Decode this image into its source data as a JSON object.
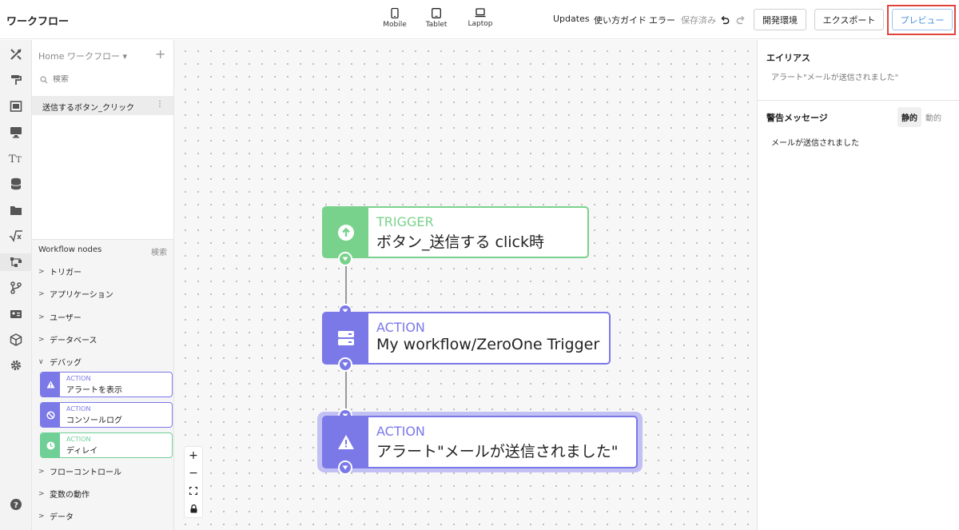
{
  "app": {
    "title": "ワークフロー"
  },
  "devices": {
    "mobile": "Mobile",
    "tablet": "Tablet",
    "laptop": "Laptop"
  },
  "toolbar": {
    "updates": "Updates",
    "guide": "使い方ガイド",
    "error": "エラー",
    "saved": "保存済み",
    "dev_env": "開発環境",
    "export": "エクスポート",
    "preview": "プレビュー"
  },
  "left_panel": {
    "header": "Home ワークフロー ▾",
    "search_placeholder": "検索",
    "workflow_item": "送信するボタン_クリック",
    "nodes_title": "Workflow nodes",
    "nodes_search": "検索",
    "categories": [
      "トリガー",
      "アプリケーション",
      "ユーザー",
      "データベース",
      "デバッグ",
      "フローコントロール",
      "変数の動作",
      "データ"
    ],
    "debug_nodes": [
      {
        "kind": "ACTION",
        "name": "アラートを表示",
        "color": "#7b78e8"
      },
      {
        "kind": "ACTION",
        "name": "コンソールログ",
        "color": "#7b78e8"
      },
      {
        "kind": "ACTION",
        "name": "ディレイ",
        "color": "#6fcf97"
      }
    ]
  },
  "canvas": {
    "nodes": [
      {
        "kind": "TRIGGER",
        "name": "ボタン_送信する click時",
        "color": "#79d28b"
      },
      {
        "kind": "ACTION",
        "name": "My workflow/ZeroOne Trigger",
        "color": "#7b78e8"
      },
      {
        "kind": "ACTION",
        "name": "アラート\"メールが送信されました\"",
        "color": "#7b78e8"
      }
    ]
  },
  "right_panel": {
    "alias_label": "エイリアス",
    "alias_placeholder": "アラート\"メールが送信されました\"",
    "message_label": "警告メッセージ",
    "mode_static": "静的",
    "mode_dynamic": "動的",
    "message_value": "メールが送信されました"
  },
  "colors": {
    "accent": "#4a90e2",
    "highlight": "#e0443a",
    "trigger": "#79d28b",
    "action": "#7b78e8"
  }
}
